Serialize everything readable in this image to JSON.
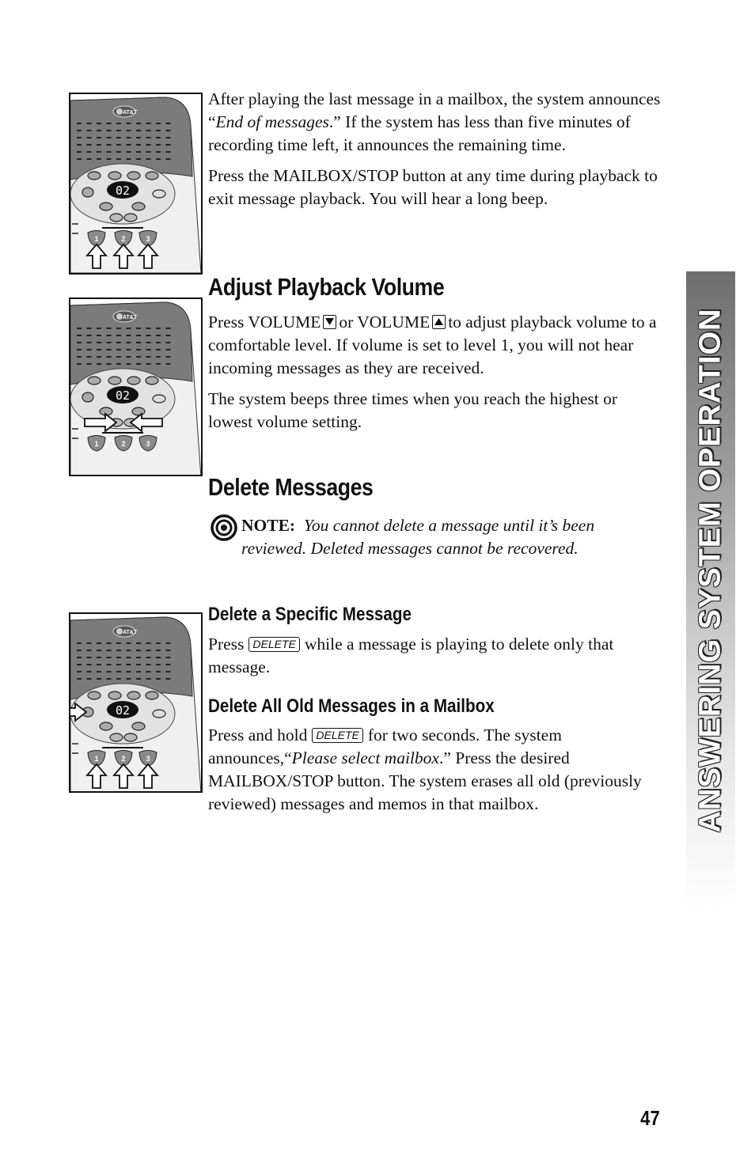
{
  "page": {
    "number": "47",
    "side_tab": "ANSWERING SYSTEM OPERATION"
  },
  "intro": {
    "p1_pre": "After playing the last message in a mailbox, the system announces “",
    "p1_italic": "End of messages",
    "p1_post": ".”  If the system has less than five minutes of recording time left, it announces the remaining time.",
    "p2": "Press the MAILBOX/STOP button at any time during playback to exit message playback. You will hear a long beep."
  },
  "adjust_volume": {
    "heading": "Adjust Playback Volume",
    "p1_a": "Press VOLUME",
    "p1_b": "or VOLUME",
    "p1_c": "to adjust playback volume to  a comfortable level.  If volume is set to level 1, you will not hear incoming messages as they are received.",
    "p2": "The system beeps three times when you reach the highest or lowest volume setting.",
    "icons": [
      "volume-down-key-icon",
      "volume-up-key-icon"
    ]
  },
  "delete_messages": {
    "heading": "Delete Messages",
    "note_label": "NOTE:",
    "note_text": "You cannot delete a message until it’s been reviewed.  Deleted messages cannot be recovered.",
    "specific": {
      "heading": "Delete a Specific Message",
      "pre": "Press",
      "button": "DELETE",
      "post": "while a message is playing to delete only that message."
    },
    "all_old": {
      "heading": "Delete All Old Messages in a Mailbox",
      "pre": "Press and hold",
      "button": "DELETE",
      "mid": "for two seconds. The system announces,“",
      "italic": "Please select mailbox",
      "post": ".”  Press the desired MAILBOX/STOP button. The system erases all old (previously reviewed) messages and memos in that mailbox."
    }
  },
  "device": {
    "brand": "AT&T",
    "display": "02",
    "mailbox_buttons": [
      "1",
      "2",
      "3"
    ]
  }
}
